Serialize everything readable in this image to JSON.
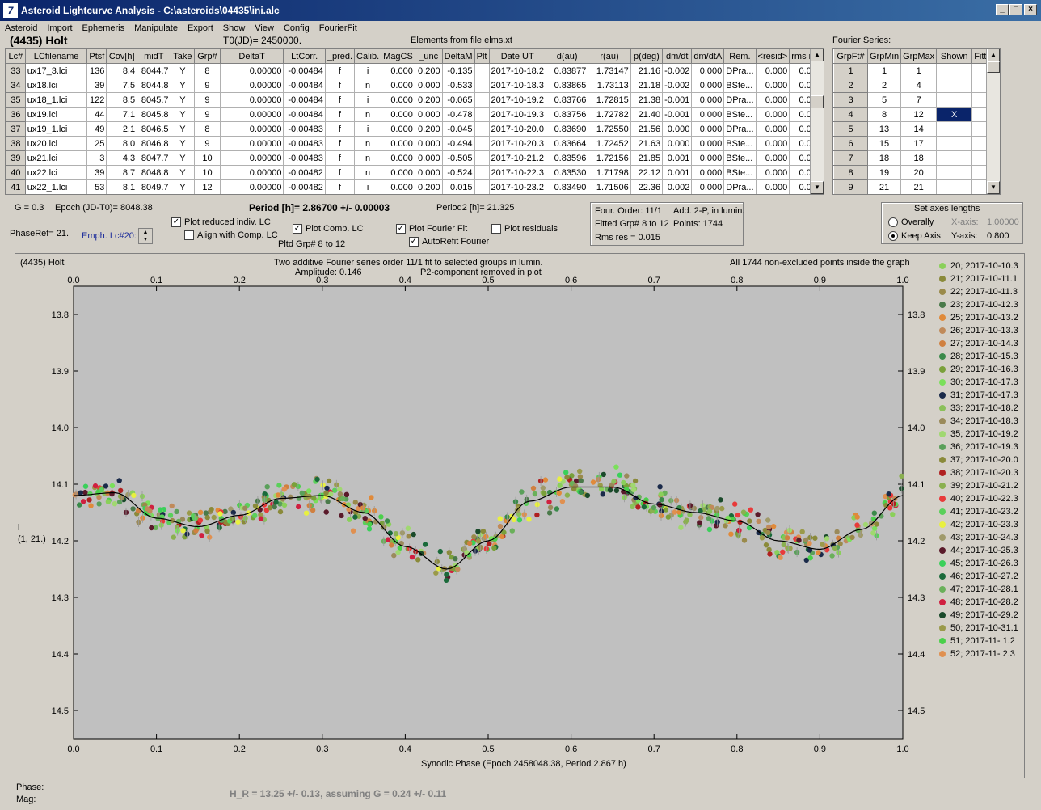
{
  "window": {
    "title": "Asteroid Lightcurve Analysis - C:\\asteroids\\04435\\ini.alc",
    "app_icon": "7"
  },
  "menu": [
    "Asteroid",
    "Import",
    "Ephemeris",
    "Manipulate",
    "Export",
    "Show",
    "View",
    "Config",
    "FourierFit"
  ],
  "header": {
    "asteroid_name": "(4435) Holt",
    "t0": "T0(JD)= 2450000.",
    "elements": "Elements from file elms.xt",
    "fourier_series_label": "Fourier Series:"
  },
  "lc_table": {
    "columns": [
      "Lc#",
      "LCfilename",
      "Ptsf",
      "Cov[h]",
      "midT",
      "Take",
      "Grp#",
      "DeltaT",
      "LtCorr.",
      "_pred.",
      "Calib.",
      "MagCS",
      "_unc",
      "DeltaM",
      "Plt",
      "Date UT",
      "d(au)",
      "r(au)",
      "p(deg)",
      "dm/dt",
      "dm/dtA",
      "Rem.",
      "<resid>",
      "rms res"
    ],
    "rows": [
      [
        "33",
        "ux17_3.lci",
        "136",
        "8.4",
        "8044.7",
        "Y",
        "8",
        "0.00000",
        "-0.00484",
        "f",
        "i",
        "0.000",
        "0.200",
        "-0.135",
        "",
        "2017-10-18.2",
        "0.83877",
        "1.73147",
        "21.16",
        "-0.002",
        "0.000",
        "DPra...",
        "0.000",
        "0.015"
      ],
      [
        "34",
        "ux18.lci",
        "39",
        "7.5",
        "8044.8",
        "Y",
        "9",
        "0.00000",
        "-0.00484",
        "f",
        "n",
        "0.000",
        "0.000",
        "-0.533",
        "",
        "2017-10-18.3",
        "0.83865",
        "1.73113",
        "21.18",
        "-0.002",
        "0.000",
        "BSte...",
        "0.000",
        "0.013"
      ],
      [
        "35",
        "ux18_1.lci",
        "122",
        "8.5",
        "8045.7",
        "Y",
        "9",
        "0.00000",
        "-0.00484",
        "f",
        "i",
        "0.000",
        "0.200",
        "-0.065",
        "",
        "2017-10-19.2",
        "0.83766",
        "1.72815",
        "21.38",
        "-0.001",
        "0.000",
        "DPra...",
        "0.000",
        "0.015"
      ],
      [
        "36",
        "ux19.lci",
        "44",
        "7.1",
        "8045.8",
        "Y",
        "9",
        "0.00000",
        "-0.00484",
        "f",
        "n",
        "0.000",
        "0.000",
        "-0.478",
        "",
        "2017-10-19.3",
        "0.83756",
        "1.72782",
        "21.40",
        "-0.001",
        "0.000",
        "BSte...",
        "0.000",
        "0.012"
      ],
      [
        "37",
        "ux19_1.lci",
        "49",
        "2.1",
        "8046.5",
        "Y",
        "8",
        "0.00000",
        "-0.00483",
        "f",
        "i",
        "0.000",
        "0.200",
        "-0.045",
        "",
        "2017-10-20.0",
        "0.83690",
        "1.72550",
        "21.56",
        "0.000",
        "0.000",
        "DPra...",
        "0.000",
        "0.016"
      ],
      [
        "38",
        "ux20.lci",
        "25",
        "8.0",
        "8046.8",
        "Y",
        "9",
        "0.00000",
        "-0.00483",
        "f",
        "n",
        "0.000",
        "0.000",
        "-0.494",
        "",
        "2017-10-20.3",
        "0.83664",
        "1.72452",
        "21.63",
        "0.000",
        "0.000",
        "BSte...",
        "0.000",
        "0.013"
      ],
      [
        "39",
        "ux21.lci",
        "3",
        "4.3",
        "8047.7",
        "Y",
        "10",
        "0.00000",
        "-0.00483",
        "f",
        "n",
        "0.000",
        "0.000",
        "-0.505",
        "",
        "2017-10-21.2",
        "0.83596",
        "1.72156",
        "21.85",
        "0.001",
        "0.000",
        "BSte...",
        "0.000",
        "0.006"
      ],
      [
        "40",
        "ux22.lci",
        "39",
        "8.7",
        "8048.8",
        "Y",
        "10",
        "0.00000",
        "-0.00482",
        "f",
        "n",
        "0.000",
        "0.000",
        "-0.524",
        "",
        "2017-10-22.3",
        "0.83530",
        "1.71798",
        "22.12",
        "0.001",
        "0.000",
        "BSte...",
        "0.000",
        "0.016"
      ],
      [
        "41",
        "ux22_1.lci",
        "53",
        "8.1",
        "8049.7",
        "Y",
        "12",
        "0.00000",
        "-0.00482",
        "f",
        "i",
        "0.000",
        "0.200",
        "0.015",
        "",
        "2017-10-23.2",
        "0.83490",
        "1.71506",
        "22.36",
        "0.002",
        "0.000",
        "DPra...",
        "0.000",
        "0.014"
      ]
    ]
  },
  "fourier_table": {
    "columns": [
      "GrpFt#",
      "GrpMin",
      "GrpMax",
      "Shown",
      "Fitte"
    ],
    "rows": [
      [
        "1",
        "1",
        "1",
        "",
        "T"
      ],
      [
        "2",
        "2",
        "4",
        "",
        "T"
      ],
      [
        "3",
        "5",
        "7",
        "",
        "T"
      ],
      [
        "4",
        "8",
        "12",
        "X",
        "T"
      ],
      [
        "5",
        "13",
        "14",
        "",
        "T"
      ],
      [
        "6",
        "15",
        "17",
        "",
        "T"
      ],
      [
        "7",
        "18",
        "18",
        "",
        "T"
      ],
      [
        "8",
        "19",
        "20",
        "",
        "T"
      ],
      [
        "9",
        "21",
        "21",
        "",
        "T"
      ]
    ]
  },
  "controls": {
    "g": "G = 0.3",
    "epoch": "Epoch (JD-T0)= 8048.38",
    "period": "Period [h]= 2.86700 +/- 0.00003",
    "period2": "Period2 [h]= 21.325",
    "phaseref": "PhaseRef= 21.",
    "emph": "Emph. Lc#20:",
    "plot_reduced": "Plot reduced indiv. LC",
    "align_comp": "Align with Comp. LC",
    "plot_comp": "Plot Comp. LC",
    "pltd_grp": "Pltd Grp#  8   to   12",
    "plot_fourier": "Plot Fourier Fit",
    "autorefit": "AutoRefit Fourier",
    "plot_residuals": "Plot residuals",
    "four_order": "Four. Order: 11/1",
    "add_2p": "Add. 2-P, in lumin.",
    "fitted_grp": "Fitted Grp# 8 to 12",
    "points": "Points: 1744",
    "rms_res": "Rms res     = 0.015",
    "axes_title": "Set axes lengths",
    "overally": "Overally",
    "keep_axis": "Keep Axis",
    "xaxis_label": "X-axis:",
    "xaxis_val": "1.00000",
    "yaxis_label": "Y-axis:",
    "yaxis_val": "0.800"
  },
  "plot": {
    "name": "(4435) Holt",
    "caption1": "Two additive Fourier series order 11/1 fit to selected groups in lumin.",
    "caption2": "Amplitude: 0.146",
    "caption3": "P2-component removed in plot",
    "caption_right": "All 1744 non-excluded points inside the graph",
    "ylabel1": "i",
    "ylabel2": "(1, 21.)",
    "xlabel": "Synodic Phase (Epoch 2458048.38, Period 2.867 h)"
  },
  "chart_data": {
    "type": "scatter",
    "x": {
      "min": 0.0,
      "max": 1.0,
      "ticks": [
        "0.0",
        "0.1",
        "0.2",
        "0.3",
        "0.4",
        "0.5",
        "0.6",
        "0.7",
        "0.8",
        "0.9",
        "1.0"
      ]
    },
    "y": {
      "min": 13.75,
      "max": 14.55,
      "inverted": true,
      "ticks": [
        "13.8",
        "13.9",
        "14.0",
        "14.1",
        "14.2",
        "14.3",
        "14.4",
        "14.5"
      ]
    },
    "fit_curve": [
      [
        0.0,
        14.12
      ],
      [
        0.05,
        14.115
      ],
      [
        0.1,
        14.16
      ],
      [
        0.15,
        14.175
      ],
      [
        0.2,
        14.155
      ],
      [
        0.25,
        14.125
      ],
      [
        0.3,
        14.12
      ],
      [
        0.35,
        14.15
      ],
      [
        0.4,
        14.21
      ],
      [
        0.45,
        14.25
      ],
      [
        0.5,
        14.2
      ],
      [
        0.55,
        14.13
      ],
      [
        0.6,
        14.105
      ],
      [
        0.65,
        14.105
      ],
      [
        0.7,
        14.135
      ],
      [
        0.75,
        14.15
      ],
      [
        0.8,
        14.165
      ],
      [
        0.85,
        14.2
      ],
      [
        0.9,
        14.215
      ],
      [
        0.95,
        14.18
      ],
      [
        1.0,
        14.12
      ]
    ],
    "series": [
      {
        "name": "20; 2017-10-10.3",
        "color": "#8ad05a"
      },
      {
        "name": "21; 2017-10-11.1",
        "color": "#8a8a3a"
      },
      {
        "name": "22; 2017-10-11.3",
        "color": "#9a8a4a"
      },
      {
        "name": "23; 2017-10-12.3",
        "color": "#4a7a4a"
      },
      {
        "name": "25; 2017-10-13.2",
        "color": "#e08a3a"
      },
      {
        "name": "26; 2017-10-13.3",
        "color": "#c08a5a"
      },
      {
        "name": "27; 2017-10-14.3",
        "color": "#d08040"
      },
      {
        "name": "28; 2017-10-15.3",
        "color": "#3a8a4a"
      },
      {
        "name": "29; 2017-10-16.3",
        "color": "#7aa03a"
      },
      {
        "name": "30; 2017-10-17.3",
        "color": "#7ae05a"
      },
      {
        "name": "31; 2017-10-17.3",
        "color": "#1a2a4a"
      },
      {
        "name": "33; 2017-10-18.2",
        "color": "#8ac05a"
      },
      {
        "name": "34; 2017-10-18.3",
        "color": "#9a8a5a"
      },
      {
        "name": "35; 2017-10-19.2",
        "color": "#a0d870"
      },
      {
        "name": "36; 2017-10-19.3",
        "color": "#5aa05a"
      },
      {
        "name": "37; 2017-10-20.0",
        "color": "#8a8a3a"
      },
      {
        "name": "38; 2017-10-20.3",
        "color": "#b02020"
      },
      {
        "name": "39; 2017-10-21.2",
        "color": "#8ab050"
      },
      {
        "name": "40; 2017-10-22.3",
        "color": "#e83a3a"
      },
      {
        "name": "41; 2017-10-23.2",
        "color": "#5ad05a"
      },
      {
        "name": "42; 2017-10-23.3",
        "color": "#e8f040"
      },
      {
        "name": "43; 2017-10-24.3",
        "color": "#a09a6a"
      },
      {
        "name": "44; 2017-10-25.3",
        "color": "#5a1a2a"
      },
      {
        "name": "45; 2017-10-26.3",
        "color": "#3ad05a"
      },
      {
        "name": "46; 2017-10-27.2",
        "color": "#1a6a3a"
      },
      {
        "name": "47; 2017-10-28.1",
        "color": "#6ab05a"
      },
      {
        "name": "48; 2017-10-28.2",
        "color": "#d02040"
      },
      {
        "name": "49; 2017-10-29.2",
        "color": "#1a4a2a"
      },
      {
        "name": "50; 2017-10-31.1",
        "color": "#9a9a4a"
      },
      {
        "name": "51; 2017-11- 1.2",
        "color": "#4ad04a"
      },
      {
        "name": "52; 2017-11- 2.3",
        "color": "#e09050"
      }
    ]
  },
  "status": {
    "phase": "Phase:",
    "mag": "Mag:",
    "hr": "H_R = 13.25 +/- 0.13, assuming G = 0.24 +/- 0.11"
  }
}
